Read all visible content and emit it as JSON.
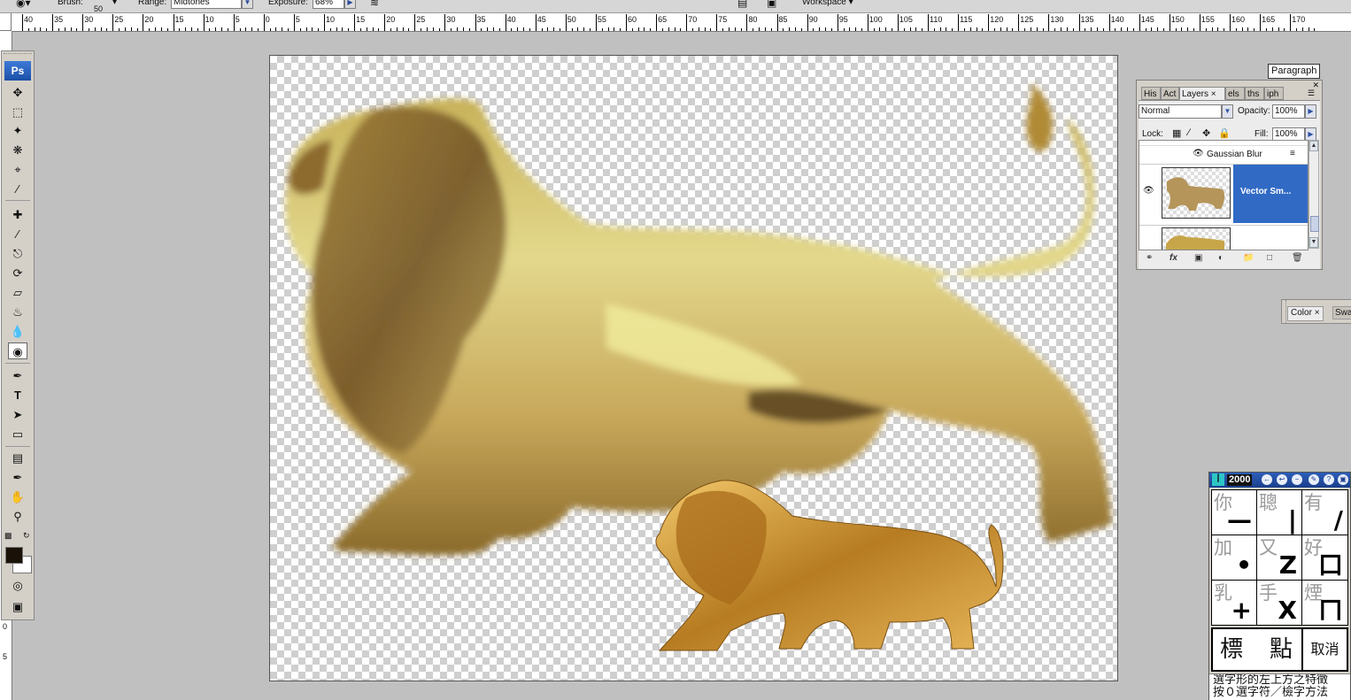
{
  "options_bar": {
    "brush_label": "Brush:",
    "brush_size": "50",
    "range_label": "Range:",
    "range_value": "Midtones",
    "exposure_label": "Exposure:",
    "exposure_value": "68%",
    "workspace_label": "Workspace"
  },
  "ruler": {
    "labels": [
      "40",
      "35",
      "30",
      "25",
      "20",
      "15",
      "10",
      "5",
      "0",
      "5",
      "10",
      "15",
      "20",
      "25",
      "30",
      "35",
      "40",
      "45",
      "50",
      "55",
      "60",
      "65",
      "70",
      "75",
      "80",
      "85",
      "90",
      "95",
      "100",
      "105",
      "110",
      "115",
      "120",
      "125",
      "130",
      "135",
      "140",
      "145",
      "150",
      "155",
      "160",
      "165",
      "170"
    ]
  },
  "vertical_ruler": {
    "labels": [
      "0",
      "5"
    ]
  },
  "toolbox": {
    "logo": "Ps"
  },
  "paragraph_tab": {
    "label": "Paragraph"
  },
  "layers_panel": {
    "tabs": [
      "His",
      "Act",
      "Layers",
      "els",
      "ths",
      "iph"
    ],
    "active_tab": "Layers",
    "blend_mode": "Normal",
    "opacity_label": "Opacity:",
    "opacity_value": "100%",
    "lock_label": "Lock:",
    "fill_label": "Fill:",
    "fill_value": "100%",
    "effect_name": "Gaussian Blur",
    "selected_layer_name": "Vector Sm..."
  },
  "color_panel": {
    "tabs": [
      "Color",
      "Swa"
    ]
  },
  "ime": {
    "title_version": "2000",
    "grid": [
      {
        "char": "你",
        "stroke": "—"
      },
      {
        "char": "聰",
        "stroke": "|"
      },
      {
        "char": "有",
        "stroke": "/"
      },
      {
        "char": "加",
        "stroke": "•"
      },
      {
        "char": "又",
        "stroke": "Z"
      },
      {
        "char": "好",
        "stroke": "口"
      },
      {
        "char": "乳",
        "stroke": "+"
      },
      {
        "char": "手",
        "stroke": "X"
      },
      {
        "char": "煙",
        "stroke": "ㄇ"
      }
    ],
    "bottom_left": "標",
    "bottom_mid": "點",
    "bottom_right": "取消",
    "status_line1": "選字形的左上方之特徵",
    "status_line2": "按０選字符／檢字方法"
  },
  "colors": {
    "ps_blue": "#1c4fa6",
    "selection_blue": "#316ac5",
    "lion_gold": "#c9a23a",
    "foreground_swatch": "#1a1208"
  }
}
